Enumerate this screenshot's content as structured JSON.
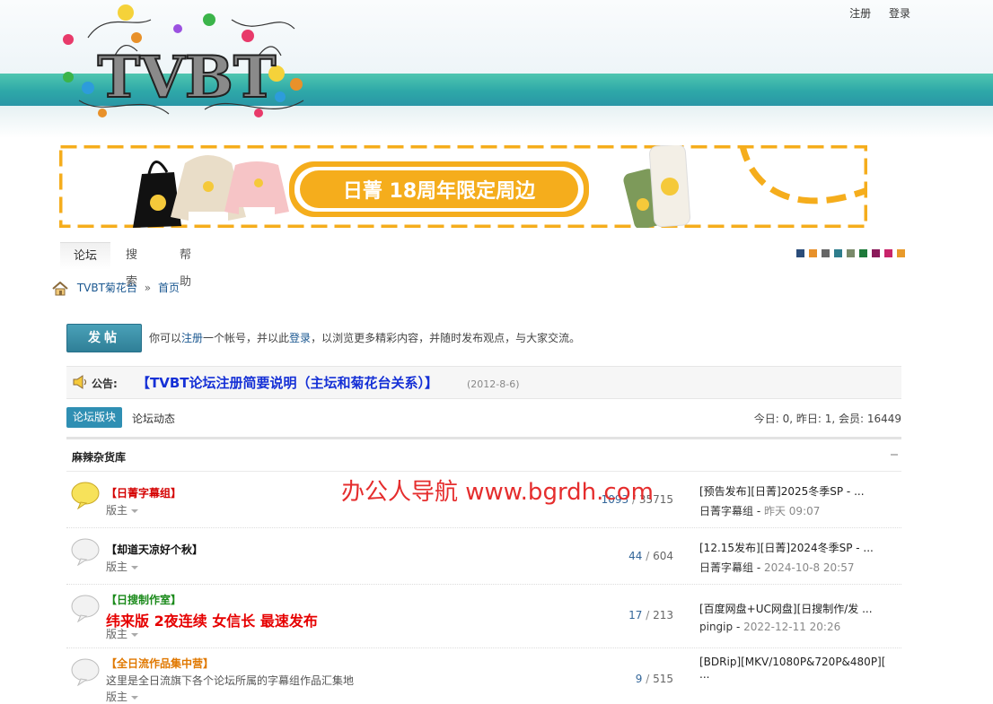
{
  "header": {
    "logo_text": "TVBT",
    "register": "注册",
    "login": "登录"
  },
  "banner": {
    "text": "日菁 18周年限定周边"
  },
  "nav": {
    "tabs": [
      "论坛",
      "搜索",
      "帮助"
    ]
  },
  "colors": {
    "swatches": [
      "#2b4d7a",
      "#e8912a",
      "#666666",
      "#2e7d8c",
      "#7a8a6a",
      "#1e7a3a",
      "#8a1a5a",
      "#c8246a",
      "#e89a2a"
    ],
    "accent": "#2f8fb3",
    "notice_title": "#1530d6",
    "promo": "#e60000"
  },
  "breadcrumb": {
    "site": "TVBT菊花台",
    "sep": "»",
    "page": "首页"
  },
  "post": {
    "button": "发帖",
    "note_1": "你可以",
    "note_register": "注册",
    "note_2": "一个帐号，并以此",
    "note_login": "登录",
    "note_3": "，以浏览更多精彩内容，并随时发布观点，与大家交流。"
  },
  "notice": {
    "label": "公告:",
    "title": "【TVBT论坛注册简要说明（主坛和菊花台关系）】",
    "date": "(2012-8-6)"
  },
  "forum_tabs": {
    "boards": "论坛版块",
    "activity": "论坛动态",
    "stats": "今日: 0, 昨日: 1, 会员: 16449"
  },
  "category": {
    "name": "麻辣杂货库"
  },
  "forums": [
    {
      "name": "【日菁字幕组】",
      "color": "#d40000",
      "moderator": "版主",
      "threads": "1093",
      "posts": "35715",
      "last_title": "[预告发布][日菁]2025冬季SP - ...",
      "last_user": "日菁字幕组",
      "last_time": "昨天 09:07"
    },
    {
      "name": "【却道天凉好个秋】",
      "color": "#111111",
      "moderator": "版主",
      "threads": "44",
      "posts": "604",
      "last_title": "[12.15发布][日菁]2024冬季SP - ...",
      "last_user": "日菁字幕组",
      "last_time": "2024-10-8 20:57"
    },
    {
      "name": "【日搜制作室】",
      "color": "#1a8a1a",
      "promo": "纬来版 2夜连续 女信长 最速发布",
      "moderator": "版主",
      "threads": "17",
      "posts": "213",
      "last_title": "[百度网盘+UC网盘][日搜制作/发 ...",
      "last_user": "pingip",
      "last_time": "2022-12-11 20:26"
    },
    {
      "name": "【全日流作品集中营】",
      "color": "#e07800",
      "desc": "这里是全日流旗下各个论坛所属的字幕组作品汇集地",
      "moderator": "版主",
      "threads": "9",
      "posts": "515",
      "last_title": "[BDRip][MKV/1080P&720P&480P][ ...",
      "last_user": "",
      "last_time": ""
    }
  ],
  "watermark": "办公人导航 www.bgrdh.com"
}
